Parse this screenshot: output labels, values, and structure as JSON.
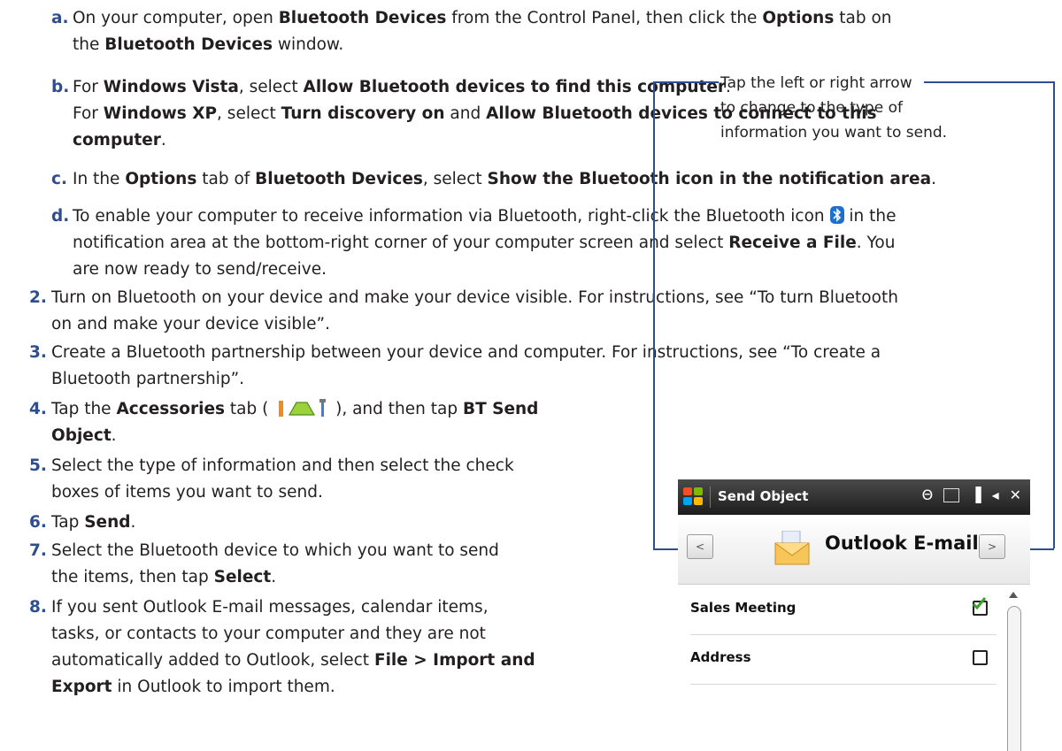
{
  "steps": {
    "a": {
      "num": "a.",
      "l1_pre": "On your computer, open ",
      "l1_b1": "Bluetooth Devices",
      "l1_mid": " from the Control Panel, then click the ",
      "l1_b2": "Options",
      "l1_post": " tab on",
      "l2_pre": "the ",
      "l2_b1": "Bluetooth Devices",
      "l2_post": " window."
    },
    "b": {
      "num": "b.",
      "l1_pre": "For ",
      "l1_b1": "Windows Vista",
      "l1_mid": ", select ",
      "l1_b2": "Allow Bluetooth devices to find this computer",
      "l1_post": ".",
      "l2_pre": "For ",
      "l2_b1": "Windows XP",
      "l2_mid": ", select ",
      "l2_b2": "Turn discovery on",
      "l2_mid2": " and ",
      "l2_b3": "Allow Bluetooth devices to connect to this",
      "l3_b1": "computer",
      "l3_post": "."
    },
    "c": {
      "num": "c.",
      "pre": "In the ",
      "b1": "Options",
      "mid": " tab of ",
      "b2": "Bluetooth Devices",
      "mid2": ", select ",
      "b3": "Show the Bluetooth icon in the notification area",
      "post": "."
    },
    "d": {
      "num": "d.",
      "l1": "To enable your computer to receive information via Bluetooth, right-click the Bluetooth icon",
      "l1_post": "in the",
      "l2_pre": "notification area at the bottom-right corner of your computer screen and select ",
      "l2_b1": "Receive a File",
      "l2_post": ". You",
      "l3": "are now ready to send/receive."
    },
    "s2": {
      "num": "2.",
      "l1": "Turn on Bluetooth on your device and make your device visible. For instructions, see “To turn Bluetooth",
      "l2": "on and make your device visible”."
    },
    "s3": {
      "num": "3.",
      "l1": "Create a Bluetooth partnership between your device and computer. For instructions, see “To create a",
      "l2": "Bluetooth partnership”."
    },
    "s4": {
      "num": "4.",
      "l1_pre": "Tap the ",
      "l1_b1": "Accessories",
      "l1_mid": " tab (",
      "l1_mid2": "), and then tap ",
      "l1_b2": "BT Send",
      "l2_b1": "Object",
      "l2_post": "."
    },
    "s5": {
      "num": "5.",
      "l1": "Select the type of information and then select the check",
      "l2": "boxes of items you want to send."
    },
    "s6": {
      "num": "6.",
      "pre": "Tap ",
      "b1": "Send",
      "post": "."
    },
    "s7": {
      "num": "7.",
      "l1": "Select the Bluetooth device to which you want to send",
      "l2_pre": "the items, then tap ",
      "l2_b1": "Select",
      "l2_post": "."
    },
    "s8": {
      "num": "8.",
      "l1": "If you sent Outlook E-mail messages, calendar items,",
      "l2": "tasks, or contacts to your computer and they are not",
      "l3_pre": "automatically added to Outlook, select ",
      "l3_b1": "File > Import and",
      "l4_b1": "Export",
      "l4_post": " in Outlook to import them."
    }
  },
  "callout": {
    "l1": "Tap the left or right arrow",
    "l2": "to change to the type of",
    "l3": "information you want to send."
  },
  "phone": {
    "title": "Send Object",
    "header_title": "Outlook E-mail",
    "left_arrow": "<",
    "right_arrow": ">",
    "items": [
      {
        "label": "Sales Meeting",
        "checked": true
      },
      {
        "label": "Address",
        "checked": false
      }
    ]
  },
  "colors": {
    "step_number": "#2f4e8f",
    "callout_line": "#2f4e8f",
    "bluetooth_icon": "#1d6fd1",
    "check_green": "#39a12a"
  },
  "icons": [
    "bluetooth-icon",
    "accessories-tab-icon",
    "windows-start-icon",
    "envelope-icon",
    "check-icon"
  ]
}
